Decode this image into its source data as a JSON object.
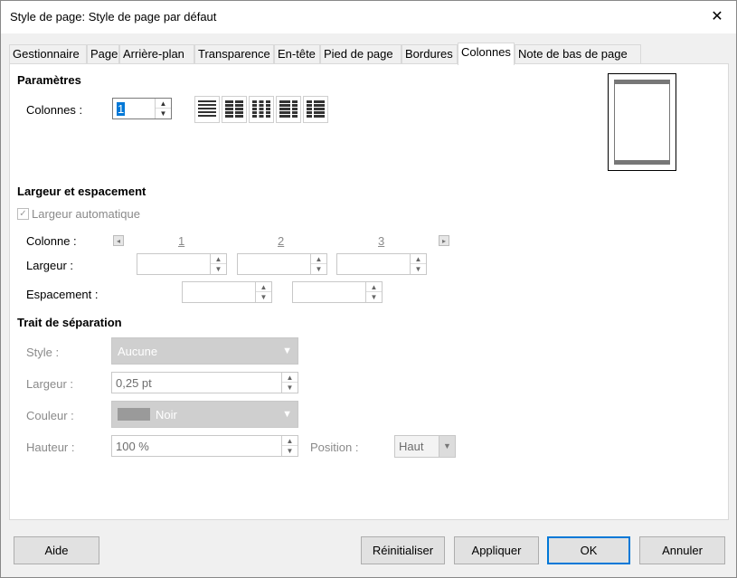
{
  "window": {
    "title": "Style de page: Style de page par défaut",
    "close_glyph": "✕"
  },
  "tabs": [
    {
      "label": "Gestionnaire"
    },
    {
      "label": "Page"
    },
    {
      "label": "Arrière-plan"
    },
    {
      "label": "Transparence"
    },
    {
      "label": "En-tête"
    },
    {
      "label": "Pied de page"
    },
    {
      "label": "Bordures"
    },
    {
      "label": "Colonnes",
      "active": true
    },
    {
      "label": "Note de bas de page"
    }
  ],
  "parametres": {
    "heading": "Paramètres",
    "colonnes_label": "Colonnes :",
    "colonnes_value": "1",
    "presets": [
      "1-column-icon",
      "2-columns-icon",
      "3-columns-icon",
      "left-wide-icon",
      "right-wide-icon"
    ]
  },
  "largeur": {
    "heading": "Largeur et espacement",
    "auto_label": "Largeur automatique",
    "auto_checked": true,
    "colonne_label": "Colonne :",
    "col_numbers": [
      "1",
      "2",
      "3"
    ],
    "largeur_label": "Largeur :",
    "espacement_label": "Espacement :"
  },
  "trait": {
    "heading": "Trait de séparation",
    "style_label": "Style :",
    "style_value": "Aucune",
    "largeur_label": "Largeur :",
    "largeur_value": "0,25 pt",
    "couleur_label": "Couleur :",
    "couleur_value": "Noir",
    "hauteur_label": "Hauteur :",
    "hauteur_value": "100 %",
    "position_label": "Position :",
    "position_value": "Haut"
  },
  "buttons": {
    "aide": "Aide",
    "reinitialiser": "Réinitialiser",
    "appliquer": "Appliquer",
    "ok": "OK",
    "annuler": "Annuler"
  }
}
